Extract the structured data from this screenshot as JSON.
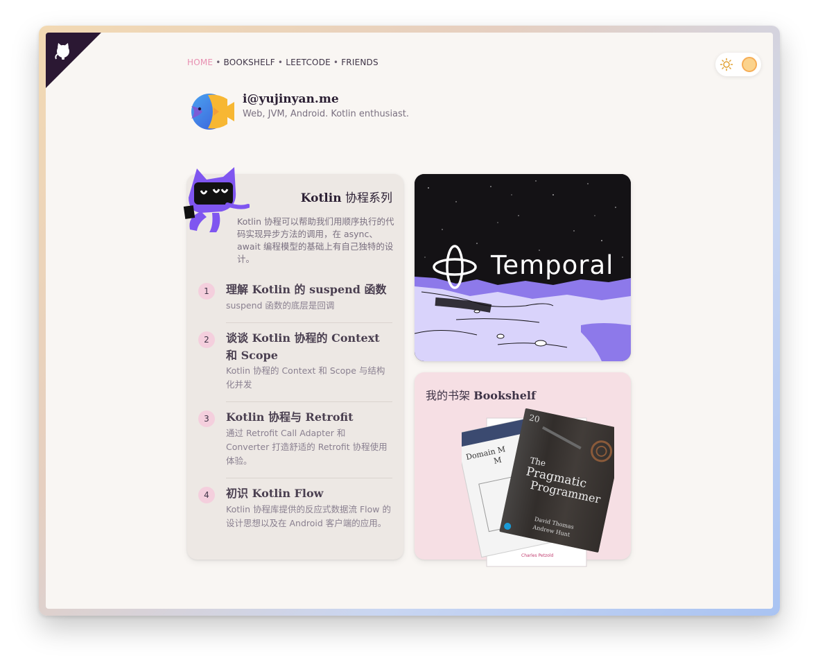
{
  "nav": {
    "items": [
      "HOME",
      "BOOKSHELF",
      "LEETCODE",
      "FRIENDS"
    ],
    "separator": "•",
    "active_color": "#e88fb1"
  },
  "profile": {
    "email": "i@yujinyan.me",
    "tagline": "Web, JVM, Android. Kotlin enthusiast."
  },
  "kotlin_series": {
    "title_bold": "Kotlin",
    "title_rest": " 协程系列",
    "description": "Kotlin 协程可以帮助我们用顺序执行的代码实现异步方法的调用，在 async、await 编程模型的基础上有自己独特的设计。",
    "articles": [
      {
        "num": "1",
        "title": "理解 Kotlin 的 suspend 函数",
        "subtitle": "suspend 函数的底层是回调"
      },
      {
        "num": "2",
        "title": "谈谈 Kotlin 协程的 Context 和 Scope",
        "subtitle": "Kotlin 协程的 Context 和 Scope 与结构化并发"
      },
      {
        "num": "3",
        "title": "Kotlin 协程与 Retrofit",
        "subtitle": "通过 Retrofit Call Adapter 和 Converter 打造舒适的 Retrofit 协程使用体验。"
      },
      {
        "num": "4",
        "title": "初识 Kotlin Flow",
        "subtitle": "Kotlin 协程库提供的反应式数据流 Flow 的设计思想以及在 Android 客户端的应用。"
      }
    ]
  },
  "temporal": {
    "label": "Temporal"
  },
  "bookshelf": {
    "title_cn": "我的书架 ",
    "title_en": "Bookshelf",
    "books": {
      "front": {
        "line1": "The",
        "line2": "Pragmatic",
        "line3": "Programmer",
        "author1": "David Thomas",
        "author2": "Andrew Hunt",
        "badge": "20"
      },
      "back": {
        "line1": "Domain M",
        "line2": "M"
      },
      "bottom_author": "Charles Petzold"
    }
  },
  "icons": [
    "github-octocat-icon",
    "sun-icon",
    "fish-avatar-icon",
    "kotlin-cat-mascot-icon"
  ]
}
